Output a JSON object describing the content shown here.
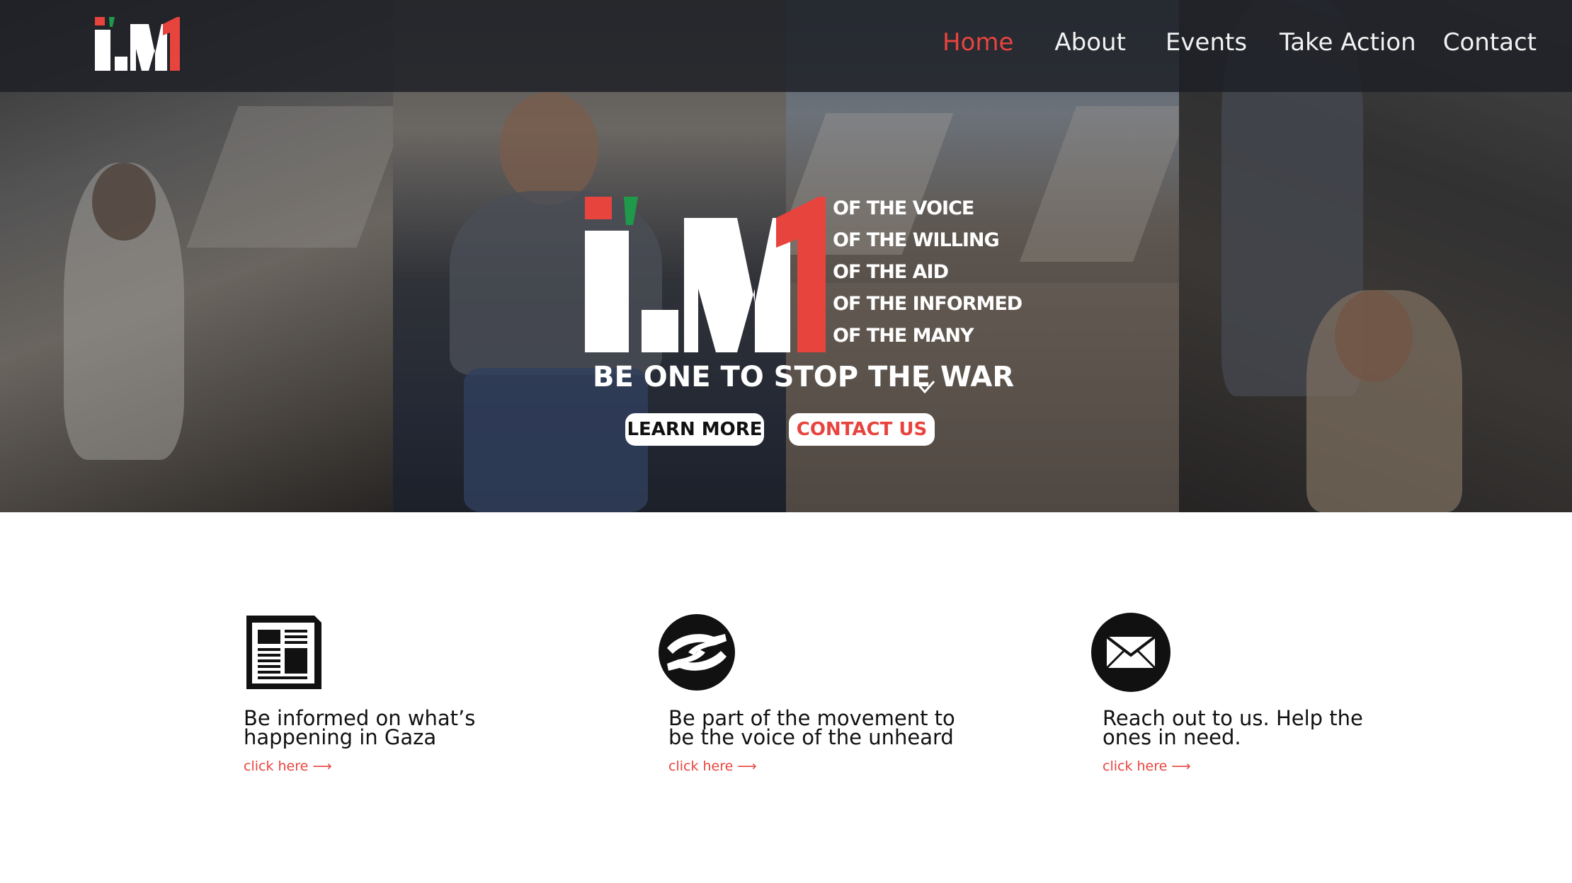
{
  "nav": {
    "items": [
      {
        "label": "Home",
        "active": true
      },
      {
        "label": "About",
        "active": false
      },
      {
        "label": "Events",
        "active": false
      },
      {
        "label": "Take Action",
        "active": false
      },
      {
        "label": "Contact",
        "active": false
      }
    ]
  },
  "brand": {
    "logo_text": "I'M1",
    "colors": {
      "red": "#e8443e",
      "green": "#1f9a4a",
      "white": "#ffffff",
      "dark": "#1c1e24"
    }
  },
  "hero": {
    "tagline": [
      "OF THE VOICE",
      "OF THE WILLING",
      "OF THE AID",
      "OF THE INFORMED",
      "OF THE MANY"
    ],
    "headline": "BE ONE TO STOP THE WAR",
    "learn_more": "LEARN MORE",
    "contact_us": "CONTACT US"
  },
  "features": [
    {
      "icon": "newspaper-icon",
      "text_line1": "Be informed on what’s",
      "text_line2": "happening in Gaza",
      "link": "click here ⟶"
    },
    {
      "icon": "helping-hands-icon",
      "text_line1": "Be part of the movement to",
      "text_line2": "be the voice of the unheard",
      "link": "click here ⟶"
    },
    {
      "icon": "envelope-icon",
      "text_line1": "Reach out to us. Help the",
      "text_line2": "ones in need.",
      "link": "click here ⟶"
    }
  ]
}
